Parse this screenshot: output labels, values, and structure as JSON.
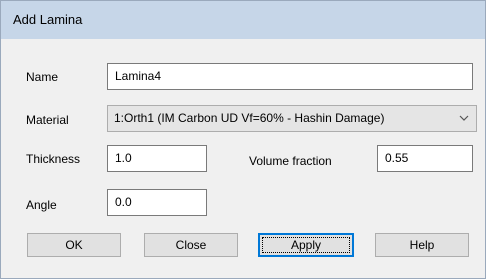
{
  "dialog": {
    "title": "Add Lamina"
  },
  "form": {
    "name_label": "Name",
    "name_value": "Lamina4",
    "material_label": "Material",
    "material_value": "1:Orth1 (IM Carbon UD Vf=60% - Hashin Damage)",
    "thickness_label": "Thickness",
    "thickness_value": "1.0",
    "volume_fraction_label": "Volume fraction",
    "volume_fraction_value": "0.55",
    "angle_label": "Angle",
    "angle_value": "0.0"
  },
  "buttons": {
    "ok": "OK",
    "close": "Close",
    "apply": "Apply",
    "help": "Help"
  },
  "colors": {
    "titlebar": "#c6d6e8",
    "dialog_background": "#f0f0f0",
    "default_button_border": "#0078d7"
  },
  "icons": {
    "dropdown": "chevron-down-icon"
  }
}
